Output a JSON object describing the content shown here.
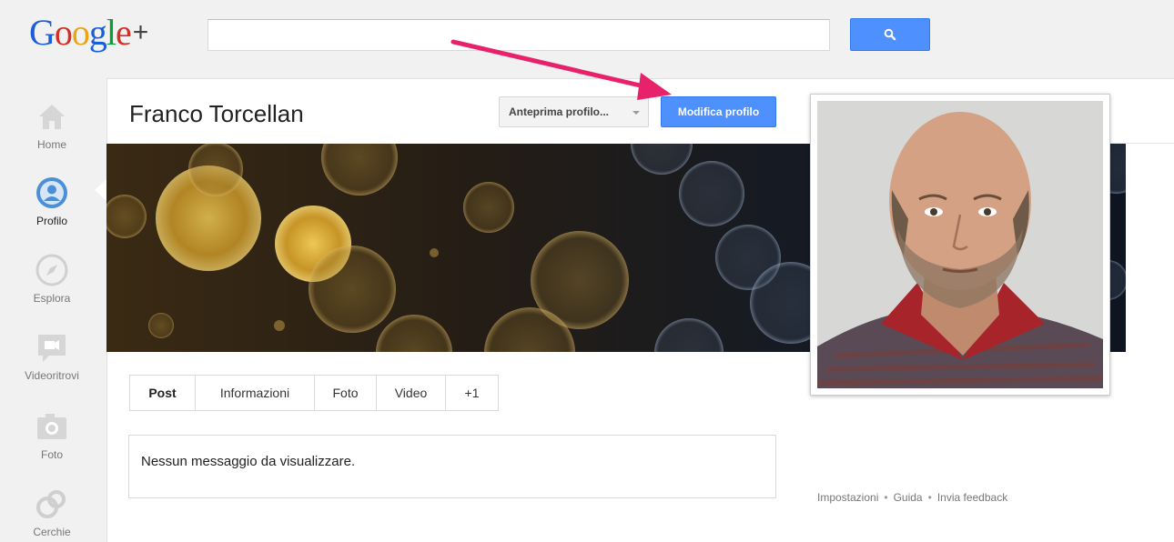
{
  "logo": {
    "letters": [
      "G",
      "o",
      "o",
      "g",
      "l",
      "e"
    ],
    "letter_colors": [
      "#1a5fd8",
      "#d22f27",
      "#e8a317",
      "#1a5fd8",
      "#109b36",
      "#d22f27"
    ],
    "plus": "+"
  },
  "search": {
    "value": "",
    "placeholder": "",
    "button_icon": "search-icon"
  },
  "sidebar": {
    "items": [
      {
        "label": "Home",
        "icon": "home-icon"
      },
      {
        "label": "Profilo",
        "icon": "profile-icon",
        "active": true
      },
      {
        "label": "Esplora",
        "icon": "compass-icon"
      },
      {
        "label": "Videoritrovi",
        "icon": "video-icon"
      },
      {
        "label": "Foto",
        "icon": "camera-icon"
      },
      {
        "label": "Cerchie",
        "icon": "circles-icon"
      }
    ]
  },
  "profile": {
    "name": "Franco Torcellan",
    "preview_label": "Anteprima profilo...",
    "edit_label": "Modifica profilo"
  },
  "tabs": [
    {
      "label": "Post",
      "active": true
    },
    {
      "label": "Informazioni"
    },
    {
      "label": "Foto"
    },
    {
      "label": "Video"
    },
    {
      "label": "+1"
    }
  ],
  "stream": {
    "empty_message": "Nessun messaggio da visualizzare."
  },
  "footer": {
    "settings": "Impostazioni",
    "help": "Guida",
    "feedback": "Invia feedback",
    "separator": "•"
  },
  "colors": {
    "accent_blue": "#4d90fe",
    "annotation_arrow": "#e8216b"
  }
}
